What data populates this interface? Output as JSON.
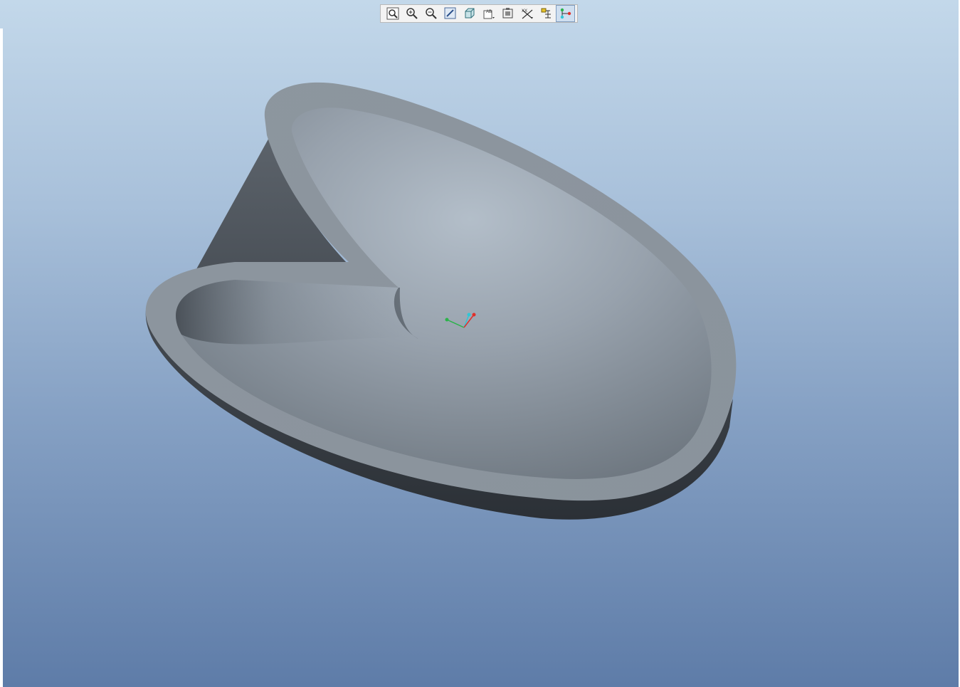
{
  "viewport": {
    "background_top": "#c3d8ea",
    "background_bottom": "#5e7ca8",
    "status_text": "",
    "model_color": "#8a939c"
  },
  "toolbar": {
    "buttons": [
      {
        "name": "refit-icon",
        "tooltip": ""
      },
      {
        "name": "zoom-in-icon",
        "tooltip": ""
      },
      {
        "name": "zoom-out-icon",
        "tooltip": ""
      },
      {
        "name": "repaint-icon",
        "tooltip": ""
      },
      {
        "name": "display-style-icon",
        "tooltip": ""
      },
      {
        "name": "saved-views-icon",
        "tooltip": ""
      },
      {
        "name": "view-manager-icon",
        "tooltip": ""
      },
      {
        "name": "datum-display-icon",
        "tooltip": ""
      },
      {
        "name": "annotation-display-icon",
        "tooltip": ""
      },
      {
        "name": "spin-center-icon",
        "tooltip": ""
      }
    ],
    "active_button": "spin-center-icon"
  },
  "triad": {
    "x_color": "#e0302a",
    "y_color": "#2bb34a",
    "z_color": "#2fc7d6"
  }
}
